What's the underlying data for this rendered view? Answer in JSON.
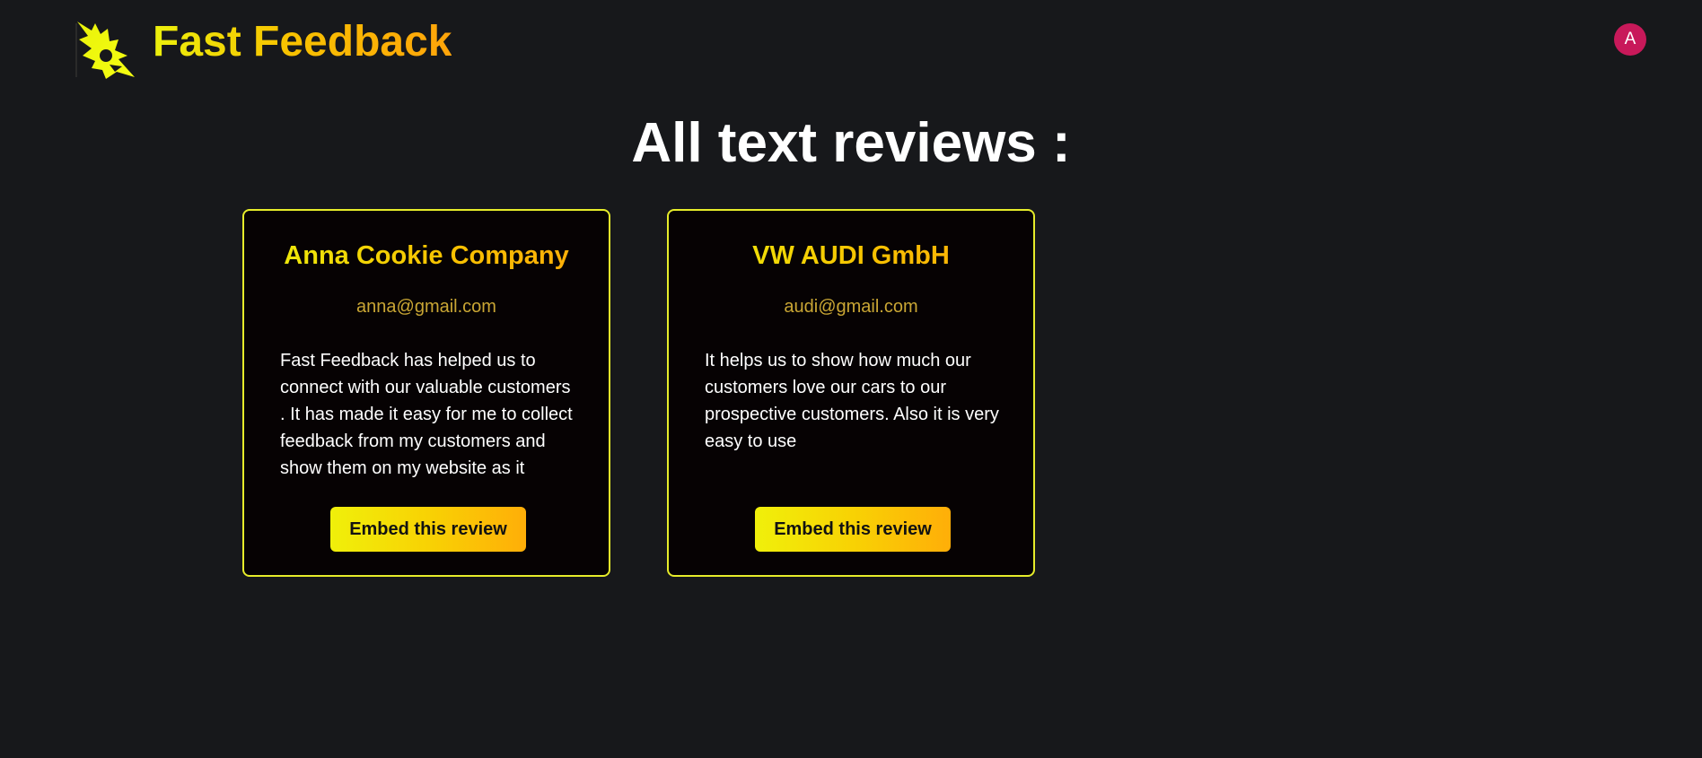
{
  "app": {
    "brand_name": "Fast Feedback",
    "logo_icon": "flame-bird-logo-icon",
    "avatar_letter": "A"
  },
  "colors": {
    "background": "#17181b",
    "brand_gradient_start": "#ecf00c",
    "brand_gradient_end": "#ffa40a",
    "card_border": "#e6ec2a",
    "card_background": "#060203",
    "email_text": "#c9a634",
    "avatar_background": "#c8195a"
  },
  "page": {
    "title": "All text reviews :"
  },
  "reviews": [
    {
      "name": "Anna Cookie Company",
      "email": "anna@gmail.com",
      "text": "Fast Feedback has helped us to connect with our valuable customers . It has made it easy for me to collect feedback from my customers and show them on my website as it makes easier",
      "button_label": "Embed this review"
    },
    {
      "name": "VW AUDI GmbH",
      "email": "audi@gmail.com",
      "text": "It helps us to show how much our customers love our cars to our prospective customers. Also it is very easy to use",
      "button_label": "Embed this review"
    }
  ]
}
